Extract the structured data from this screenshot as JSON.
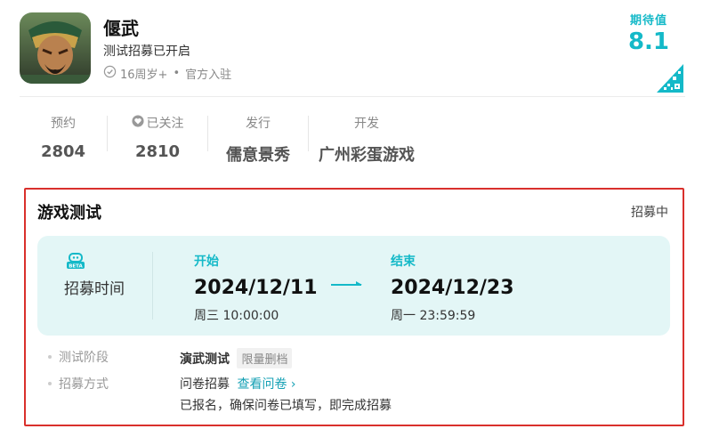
{
  "app": {
    "title": "偃武",
    "subtitle": "测试招募已开启",
    "age_rating": "16周岁+",
    "separator": "•",
    "official_tag": "官方入驻"
  },
  "rating": {
    "label": "期待值",
    "value": "8.1"
  },
  "stats": [
    {
      "label": "预约",
      "value": "2804"
    },
    {
      "label": "已关注",
      "value": "2810"
    },
    {
      "label": "发行",
      "value": "儒意景秀"
    },
    {
      "label": "开发",
      "value": "广州彩蛋游戏"
    }
  ],
  "test_card": {
    "title": "游戏测试",
    "status": "招募中",
    "recruit_label": "招募时间",
    "start": {
      "label": "开始",
      "date": "2024/12/11",
      "time": "周三 10:00:00"
    },
    "end": {
      "label": "结束",
      "date": "2024/12/23",
      "time": "周一 23:59:59"
    },
    "stage_key": "测试阶段",
    "stage_name": "演武测试",
    "stage_tag": "限量删档",
    "method_key": "招募方式",
    "method_value": "问卷招募",
    "method_link": "查看问卷",
    "method_note": "已报名，确保问卷已填写，即完成招募"
  },
  "colors": {
    "accent": "#14b9c8",
    "highlight_border": "#d9302c",
    "panel_bg": "#e3f6f6"
  }
}
